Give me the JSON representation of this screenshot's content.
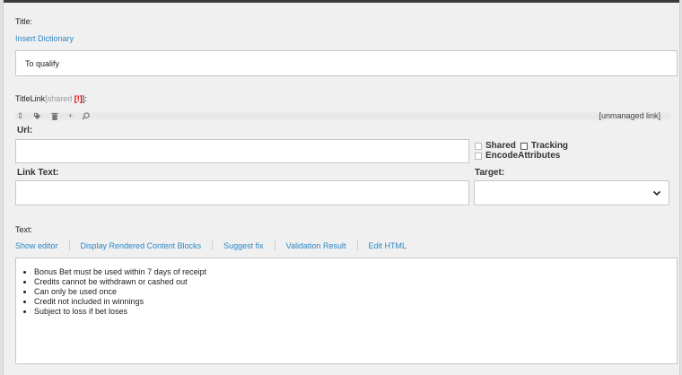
{
  "title_field": {
    "label": "Title:",
    "insert_dictionary": "Insert Dictionary",
    "value": "To qualify"
  },
  "titlelink_field": {
    "label": "TitleLink",
    "shared_prefix": "[shared ",
    "shared_mark": "[!]",
    "shared_suffix": "]:",
    "toolbar_icons": [
      "sort-icon",
      "tag-icon",
      "trash-icon",
      "plus-icon",
      "search-icon"
    ],
    "unmanaged": "[unmanaged link]",
    "url_label": "Url:",
    "url_value": "",
    "shared_label": "Shared",
    "tracking_label": "Tracking",
    "encode_label": "EncodeAttributes",
    "link_text_label": "Link Text:",
    "link_text_value": "",
    "target_label": "Target:",
    "target_value": ""
  },
  "text_field": {
    "label": "Text:",
    "tabs": [
      "Show editor",
      "Display Rendered Content Blocks",
      "Suggest fix",
      "Validation Result",
      "Edit HTML"
    ],
    "bullets": [
      "Bonus Bet must be used within 7 days of receipt",
      "Credits cannot be withdrawn or cashed out",
      "Can only be used once",
      "Credit not included in winnings",
      "Subject to loss if bet loses"
    ]
  }
}
